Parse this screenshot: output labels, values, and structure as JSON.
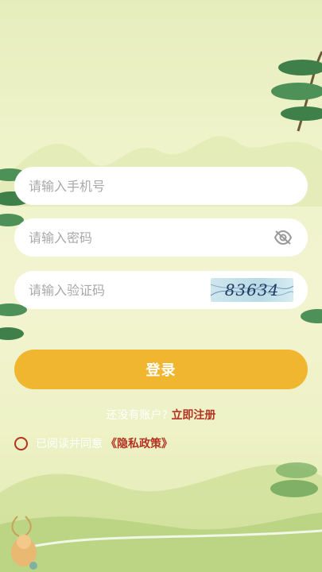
{
  "form": {
    "phone_placeholder": "请输入手机号",
    "password_placeholder": "请输入密码",
    "code_placeholder": "请输入验证码",
    "captcha_text": "83634"
  },
  "actions": {
    "login_label": "登录",
    "register_prompt": "还没有账户?",
    "register_link": "立即注册"
  },
  "agreement": {
    "text": "已阅读并同意",
    "policy_link": "《隐私政策》"
  },
  "colors": {
    "accent": "#f0b62f",
    "link": "#b33222",
    "field_bg": "#ffffff"
  },
  "icons": [
    "eye-off-icon",
    "radio-unchecked-icon",
    "pine-branch-decoration"
  ]
}
